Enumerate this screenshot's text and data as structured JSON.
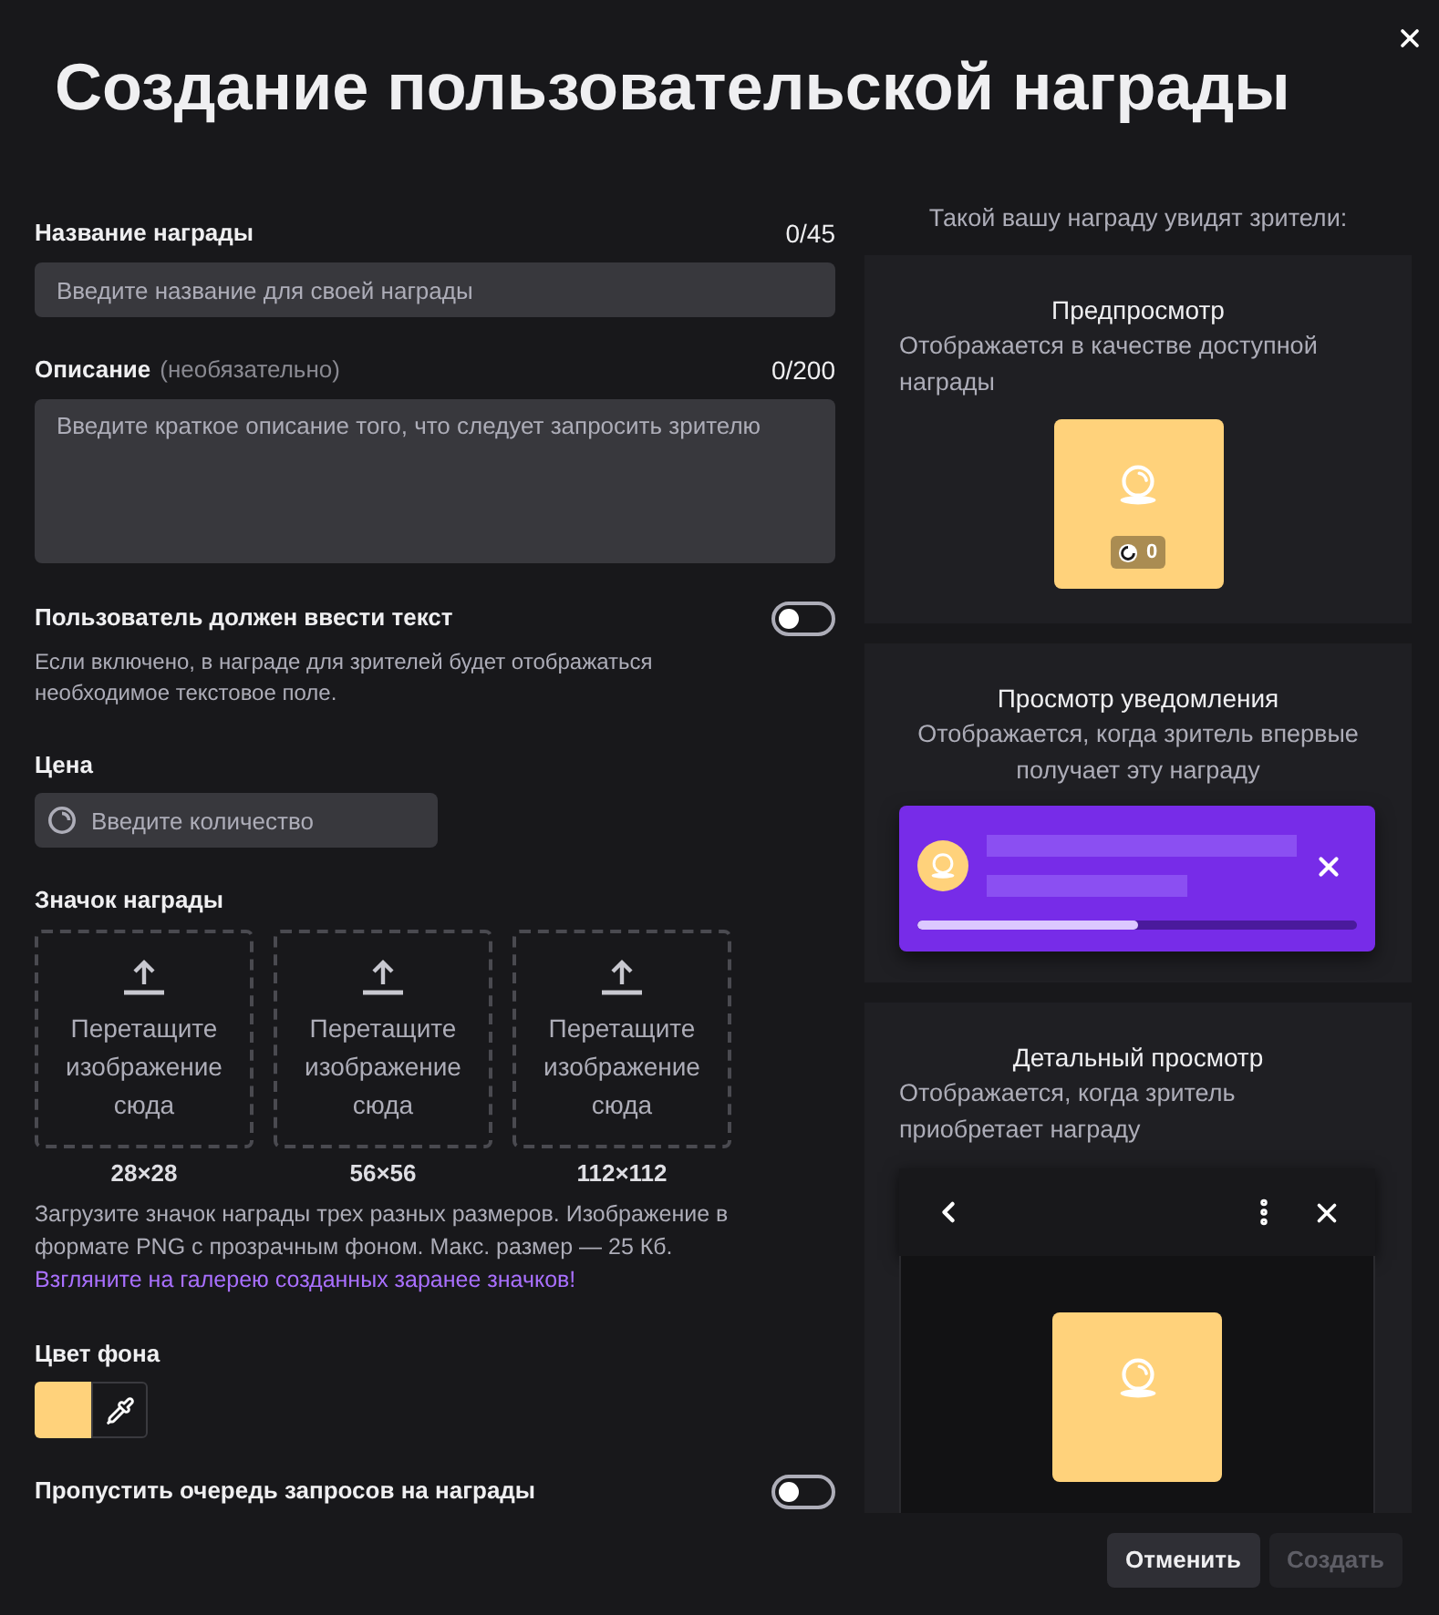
{
  "dialog": {
    "title": "Создание пользовательской награды"
  },
  "form": {
    "name_field": {
      "label": "Название награды",
      "counter": "0/45",
      "placeholder": "Введите название для своей награды"
    },
    "description_field": {
      "label": "Описание",
      "hint": "(необязательно)",
      "counter": "0/200",
      "placeholder": "Введите краткое описание того, что следует запросить зрителю"
    },
    "require_text": {
      "label": "Пользователь должен ввести текст",
      "on": false,
      "help": "Если включено, в награде для зрителей будет отображаться необходимое текстовое поле."
    },
    "price_field": {
      "label": "Цена",
      "placeholder": "Введите количество"
    },
    "icon_upload": {
      "label": "Значок награды",
      "slots": [
        {
          "prompt": "Перетащите изображение сюда",
          "size": "28×28"
        },
        {
          "prompt": "Перетащите изображение сюда",
          "size": "56×56"
        },
        {
          "prompt": "Перетащите изображение сюда",
          "size": "112×112"
        }
      ],
      "help": "Загрузите значок награды трех разных размеров. Изображение в формате PNG с прозрачным фоном. Макс. размер — 25 Кб.",
      "link": "Взгляните на галерею созданных заранее значков!"
    },
    "background_color": {
      "label": "Цвет фона",
      "color": "#ffd27b"
    },
    "skip_queue": {
      "label": "Пропустить очередь запросов на награды",
      "on": false
    }
  },
  "preview": {
    "caption": "Такой вашу награду увидят зрители:",
    "cards": [
      {
        "kind": "tile",
        "title": "Предпросмотр",
        "description": "Отображается в качестве доступной награды",
        "cost": "0"
      },
      {
        "kind": "notification",
        "title": "Просмотр уведомления",
        "description": "Отображается, когда зритель впервые получает эту награду",
        "level": 0.5
      },
      {
        "kind": "detail",
        "title": "Детальный просмотр",
        "description": "Отображается, когда зритель приобретает награду"
      }
    ]
  },
  "footer": {
    "buttons": [
      {
        "label": "Отменить",
        "disabled": false
      },
      {
        "label": "Создать",
        "disabled": true
      }
    ]
  }
}
